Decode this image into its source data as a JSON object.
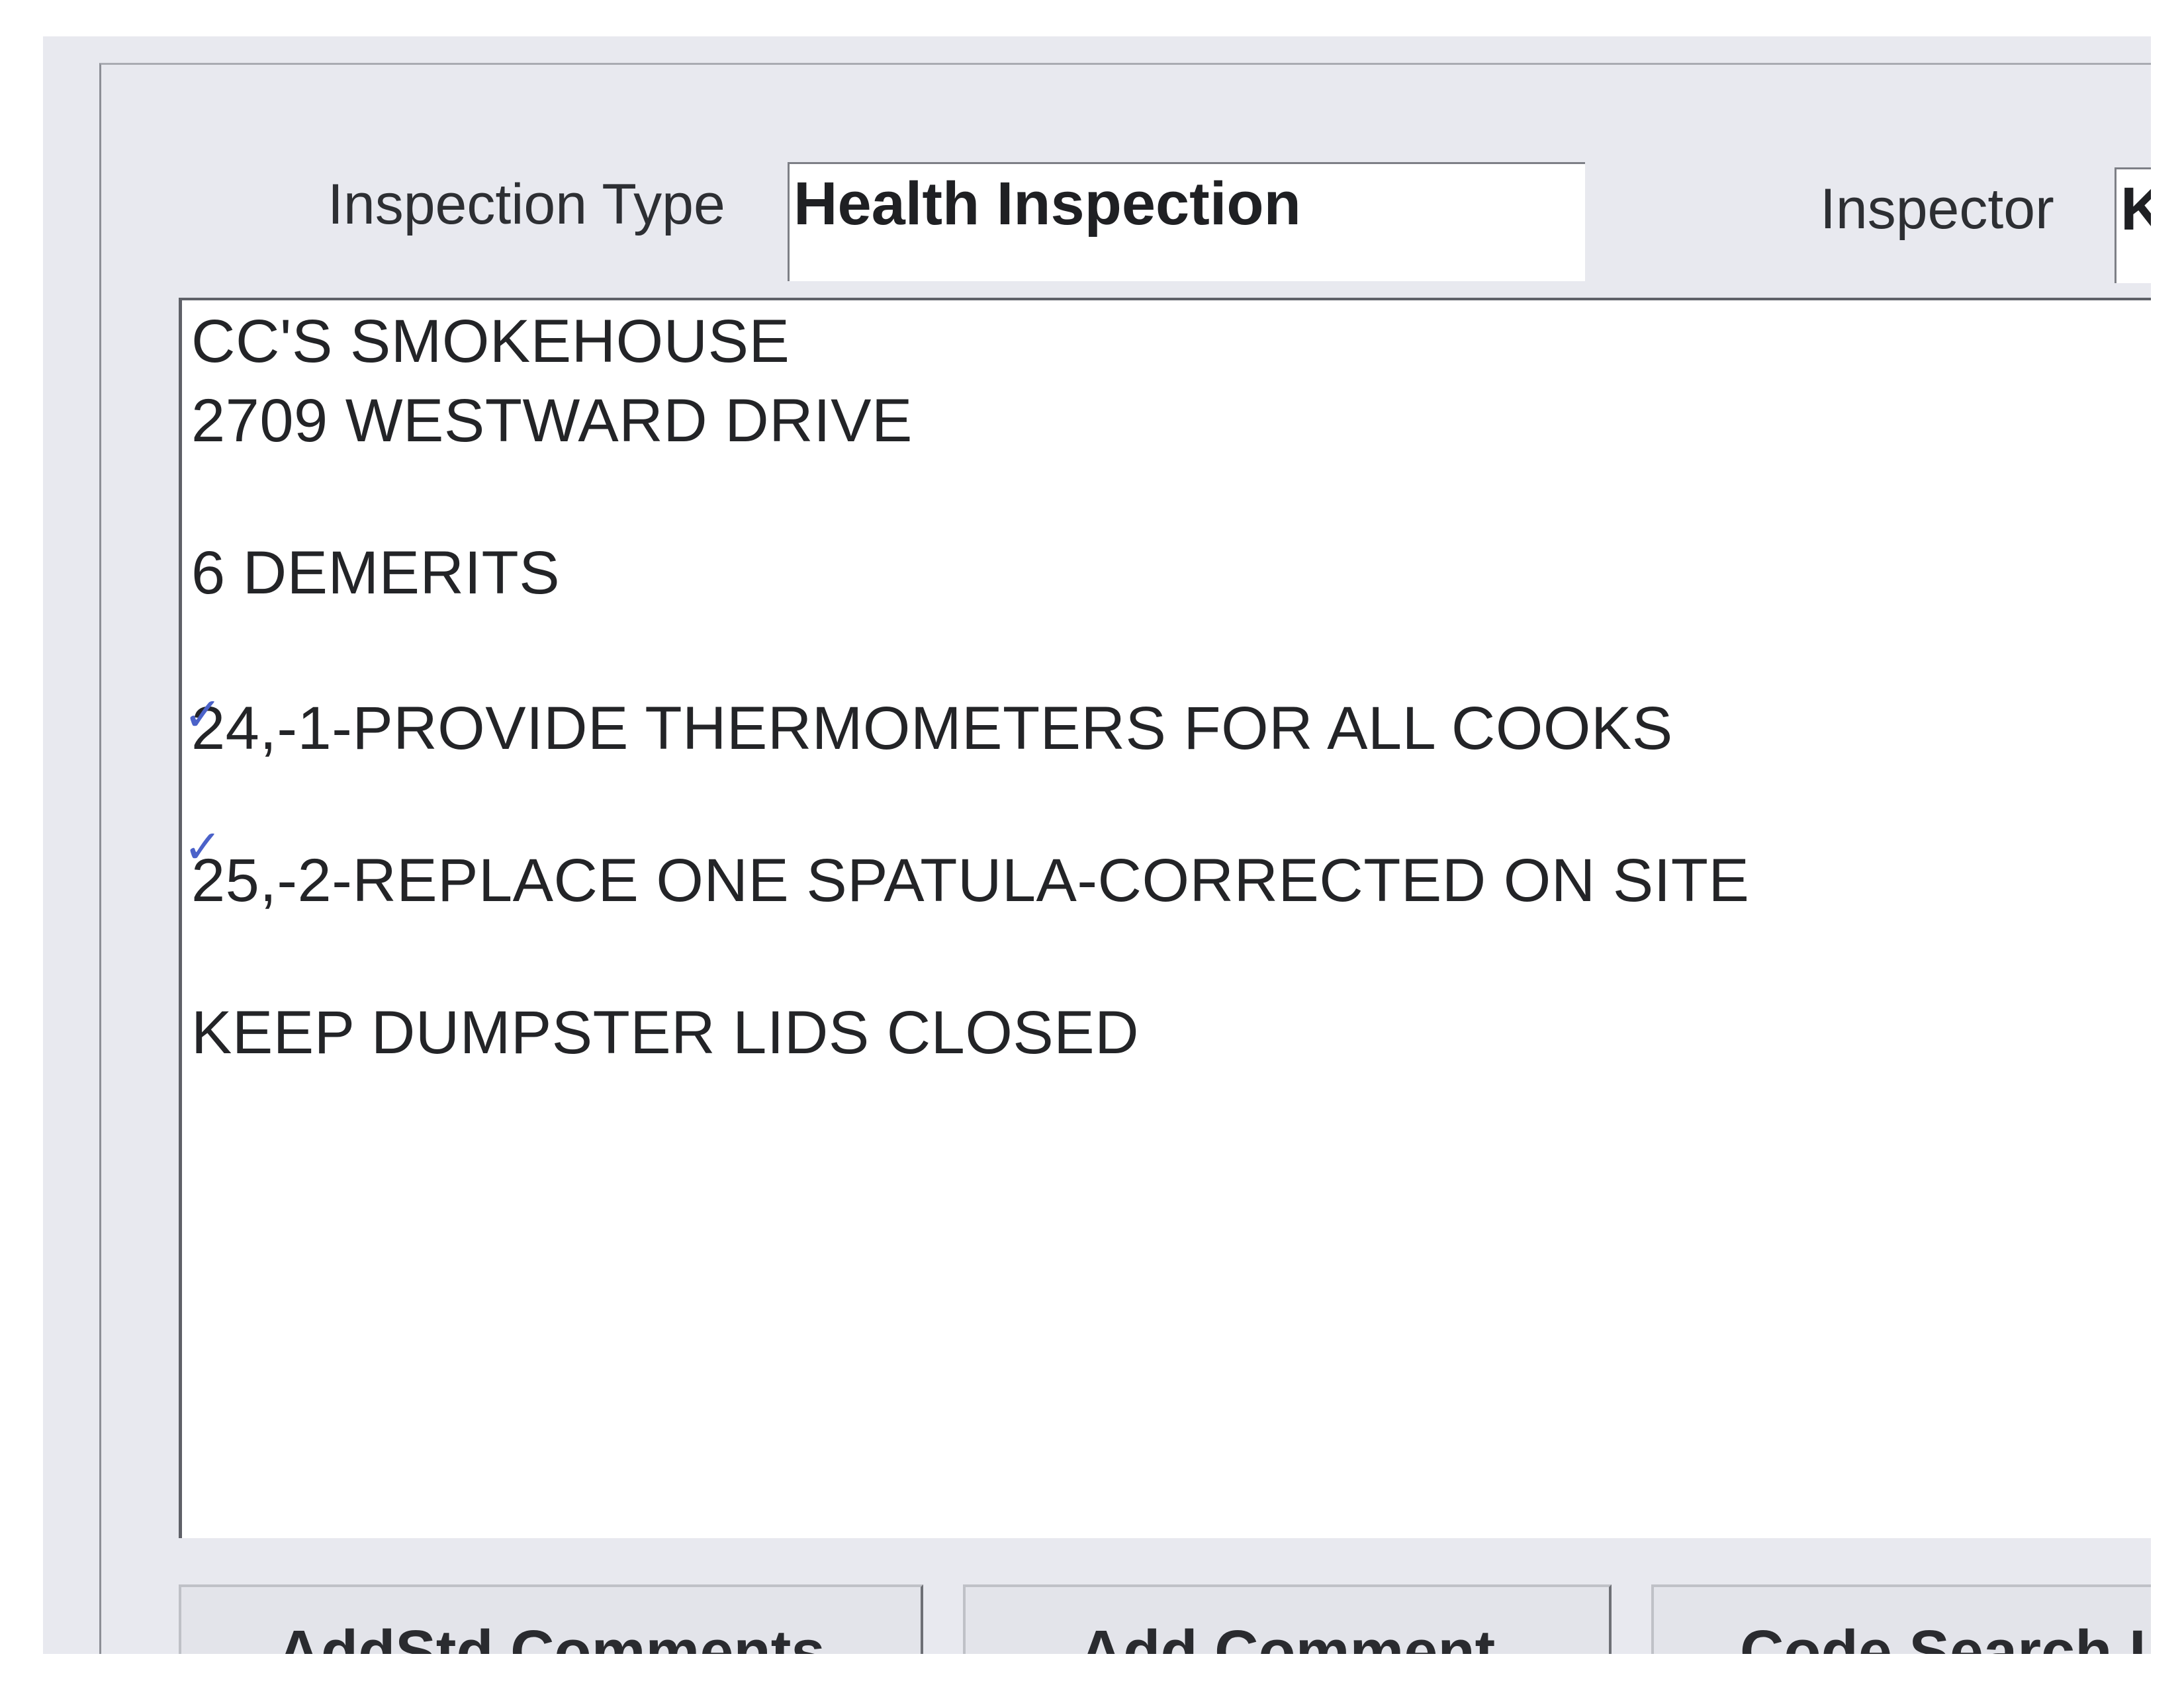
{
  "form": {
    "inspection_type_label": "Inspection Type",
    "inspection_type_value": "Health Inspection",
    "inspector_label": "Inspector",
    "inspector_value": "Ke"
  },
  "comments": {
    "lines": [
      "CC'S SMOKEHOUSE",
      "2709 WESTWARD DRIVE",
      "6 DEMERITS",
      "24,-1-PROVIDE THERMOMETERS FOR ALL COOKS",
      "25,-2-REPLACE ONE SPATULA-CORRECTED ON SITE",
      "KEEP DUMPSTER LIDS CLOSED"
    ]
  },
  "buttons": {
    "add_std_comments": {
      "before": "Add ",
      "mnemonic": "S",
      "after": "td Comments"
    },
    "add_comment": {
      "before": "",
      "mnemonic": "A",
      "after": "dd Comment"
    },
    "code_search": "Code Search Li"
  },
  "icons": {
    "handwritten_check": "check-mark-icon"
  },
  "colors": {
    "window_bg": "#e8e9ef",
    "field_bg": "#ffffff",
    "text": "#232427",
    "ink_mark": "#4b62c9"
  }
}
